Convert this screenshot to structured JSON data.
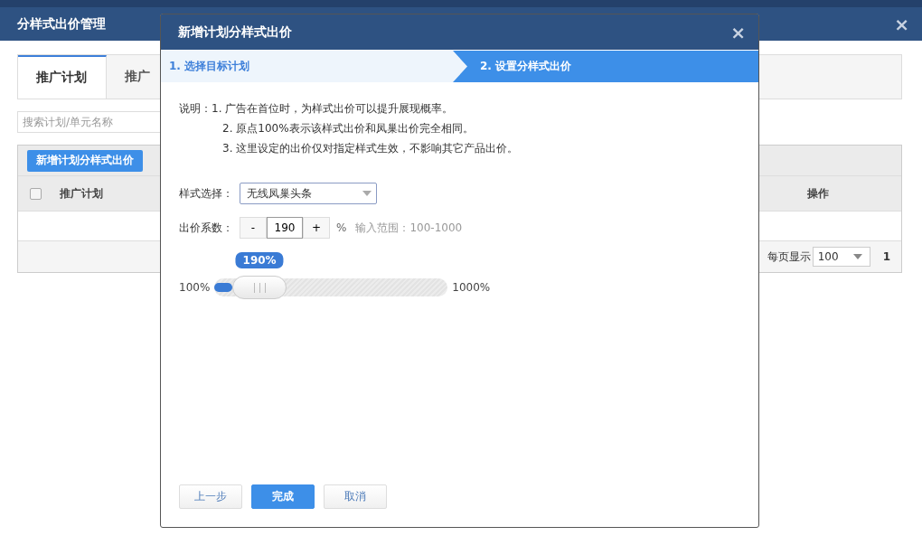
{
  "page": {
    "title": "分样式出价管理",
    "close": "×"
  },
  "tabs": [
    {
      "label": "推广计划",
      "selected": true
    },
    {
      "label": "推广",
      "selected": false
    }
  ],
  "search": {
    "placeholder": "搜索计划/单元名称"
  },
  "add_button": "新增计划分样式出价",
  "table": {
    "select_all": {
      "checked": false
    },
    "columns": [
      {
        "label": "推广计划"
      },
      {
        "label": "操作"
      }
    ]
  },
  "pagination": {
    "per_page_label": "每页显示",
    "per_page": "100",
    "page": "1"
  },
  "dialog": {
    "title": "新增计划分样式出价",
    "close": "×",
    "steps": [
      {
        "label": "1. 选择目标计划",
        "selected": false
      },
      {
        "label": "2. 设置分样式出价",
        "selected": true
      }
    ],
    "notes": {
      "label": "说明：",
      "items": [
        "1. 广告在首位时，为样式出价可以提升展现概率。",
        "2. 原点100%表示该样式出价和凤巢出价完全相同。",
        "3. 这里设定的出价仅对指定样式生效，不影响其它产品出价。"
      ]
    },
    "style_select": {
      "label": "样式选择：",
      "value": "无线凤巢头条"
    },
    "bid": {
      "label": "出价系数：",
      "minus": "-",
      "value": "190",
      "plus": "+",
      "unit": "%",
      "hint": "输入范围：100-1000"
    },
    "slider": {
      "tooltip": "190%",
      "min_label": "100%",
      "max_label": "1000%",
      "level": 0.1
    },
    "buttons": [
      {
        "label": "上一步",
        "kind": "default"
      },
      {
        "label": "完成",
        "kind": "primary"
      },
      {
        "label": "取消",
        "kind": "default"
      }
    ]
  }
}
